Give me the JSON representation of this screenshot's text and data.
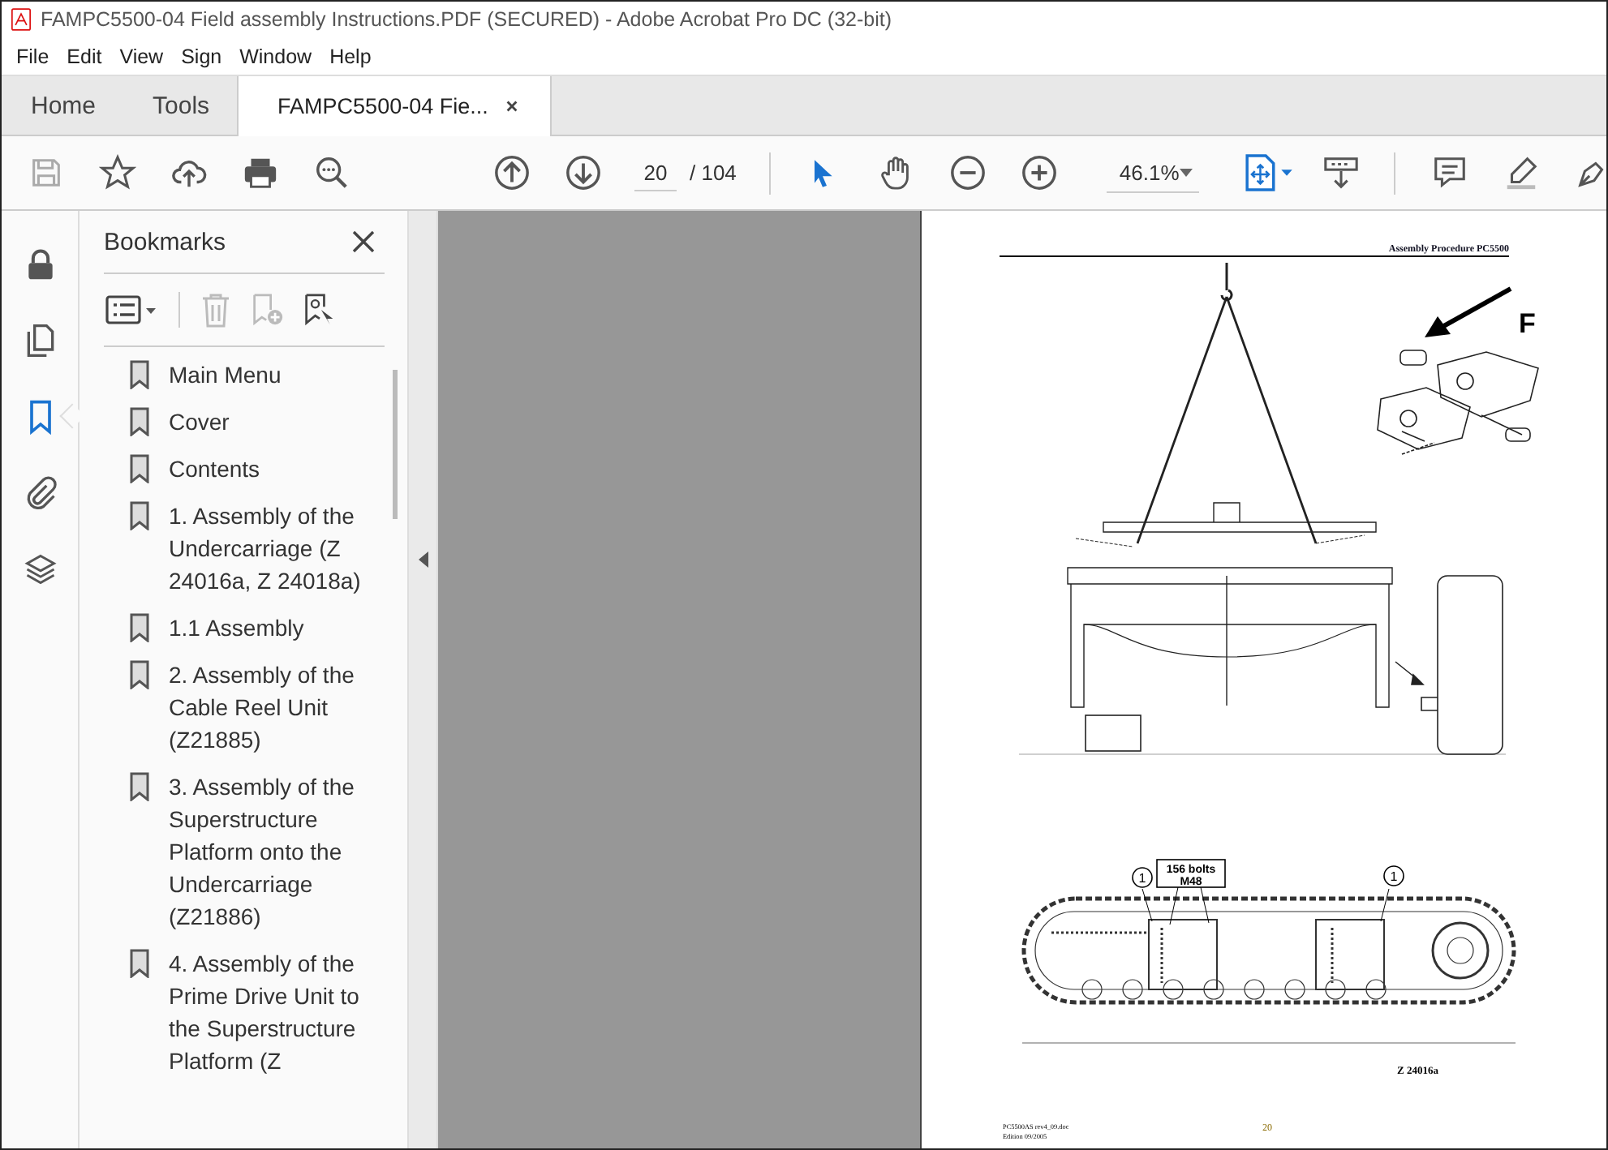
{
  "window": {
    "title": "FAMPC5500-04 Field assembly Instructions.PDF (SECURED) - Adobe Acrobat Pro DC (32-bit)"
  },
  "menu": [
    "File",
    "Edit",
    "View",
    "Sign",
    "Window",
    "Help"
  ],
  "tabs": [
    {
      "label": "Home",
      "kind": "nav",
      "selected": false
    },
    {
      "label": "Tools",
      "kind": "nav",
      "selected": false
    },
    {
      "label": "FAMPC5500-04 Fie...",
      "kind": "document",
      "selected": true
    }
  ],
  "toolbar": {
    "page": "20",
    "page_total": "/ 104",
    "zoom": "46.1%"
  },
  "rail": [
    {
      "kind": "lock",
      "selected": false
    },
    {
      "kind": "pages",
      "selected": false
    },
    {
      "kind": "bookmark",
      "selected": true
    },
    {
      "kind": "attachment",
      "selected": false
    },
    {
      "kind": "layers",
      "selected": false
    }
  ],
  "bookmarks": {
    "title": "Bookmarks",
    "items": [
      {
        "label": "Main Menu"
      },
      {
        "label": "Cover"
      },
      {
        "label": "Contents"
      },
      {
        "label": "1. Assembly of the Undercarriage  (Z 24016a, Z 24018a)"
      },
      {
        "label": "1.1 Assembly"
      },
      {
        "label": "2. Assembly of the Cable Reel Unit (Z21885)"
      },
      {
        "label": "3. Assembly of the Superstructure Platform onto the Undercarriage (Z21886)"
      },
      {
        "label": "4. Assembly of the Prime Drive Unit to the Superstructure Platform (Z"
      }
    ]
  },
  "page": {
    "header": "Assembly Procedure PC5500",
    "detail_label": "F",
    "bolts_label": "156 bolts",
    "bolts_size": "M48",
    "callouts": [
      "1",
      "1"
    ],
    "figure_number": "Z 24016a",
    "footer_file": "PC5500AS rev4_09.doc",
    "footer_edition": "Edition 09/2005",
    "page_number": "20"
  }
}
